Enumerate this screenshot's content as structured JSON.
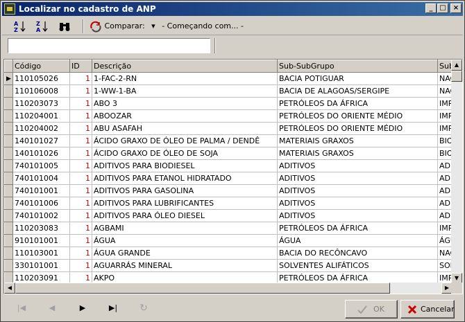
{
  "window": {
    "title": "Localizar no cadastro de ANP",
    "minimize": "_",
    "maximize": "□",
    "close": "×"
  },
  "toolbar": {
    "compare_label": "Comparar:",
    "compare_mode": "- Começando com... -"
  },
  "search": {
    "value": "",
    "placeholder": ""
  },
  "grid": {
    "columns": [
      "Código",
      "ID",
      "Descrição",
      "Sub-SubGrupo",
      "Sub"
    ],
    "rows": [
      [
        "110105026",
        "1",
        "1-FAC-2-RN",
        "BACIA POTIGUAR",
        "NAC"
      ],
      [
        "110106008",
        "1",
        "1-WW-1-BA",
        "BACIA DE ALAGOAS/SERGIPE",
        "NAC"
      ],
      [
        "110203073",
        "1",
        "ABO 3",
        "PETRÓLEOS DA ÁFRICA",
        "IMPO"
      ],
      [
        "110204001",
        "1",
        "ABOOZAR",
        "PETRÓLEOS DO ORIENTE MÉDIO",
        "IMPO"
      ],
      [
        "110204002",
        "1",
        "ABU ASAFAH",
        "PETRÓLEOS DO ORIENTE MÉDIO",
        "IMPO"
      ],
      [
        "140101027",
        "1",
        "ÁCIDO GRAXO DE ÓLEO DE PALMA / DENDÊ",
        "MATERIAIS GRAXOS",
        "BIOD"
      ],
      [
        "140101026",
        "1",
        "ÁCIDO GRAXO DE ÓLEO DE SOJA",
        "MATERIAIS GRAXOS",
        "BIOD"
      ],
      [
        "740101005",
        "1",
        "ADITIVOS PARA BIODIESEL",
        "ADITIVOS",
        "ADIT"
      ],
      [
        "740101004",
        "1",
        "ADITIVOS PARA ETANOL HIDRATADO",
        "ADITIVOS",
        "ADIT"
      ],
      [
        "740101001",
        "1",
        "ADITIVOS PARA GASOLINA",
        "ADITIVOS",
        "ADIT"
      ],
      [
        "740101006",
        "1",
        "ADITIVOS PARA LUBRIFICANTES",
        "ADITIVOS",
        "ADIT"
      ],
      [
        "740101002",
        "1",
        "ADITIVOS PARA ÓLEO DIESEL",
        "ADITIVOS",
        "ADIT"
      ],
      [
        "110203083",
        "1",
        "AGBAMI",
        "PETRÓLEOS DA ÁFRICA",
        "IMPO"
      ],
      [
        "910101001",
        "1",
        "ÁGUA",
        "ÁGUA",
        "ÁGU"
      ],
      [
        "110103001",
        "1",
        "ÁGUA GRANDE",
        "BACIA DO RECÔNCAVO",
        "NAC"
      ],
      [
        "330101001",
        "1",
        "AGUARRÁS MINERAL",
        "SOLVENTES ALIFÁTICOS",
        "SOLV"
      ],
      [
        "110203091",
        "1",
        "AKPO",
        "PETRÓLEOS DA ÁFRICA",
        "IMPO"
      ]
    ]
  },
  "buttons": {
    "ok": "OK",
    "cancel": "Cancelar"
  },
  "colors": {
    "title_start": "#0a246a",
    "title_end": "#3a6ea5",
    "id_text": "#c00000",
    "cancel_icon": "#cc0000"
  }
}
